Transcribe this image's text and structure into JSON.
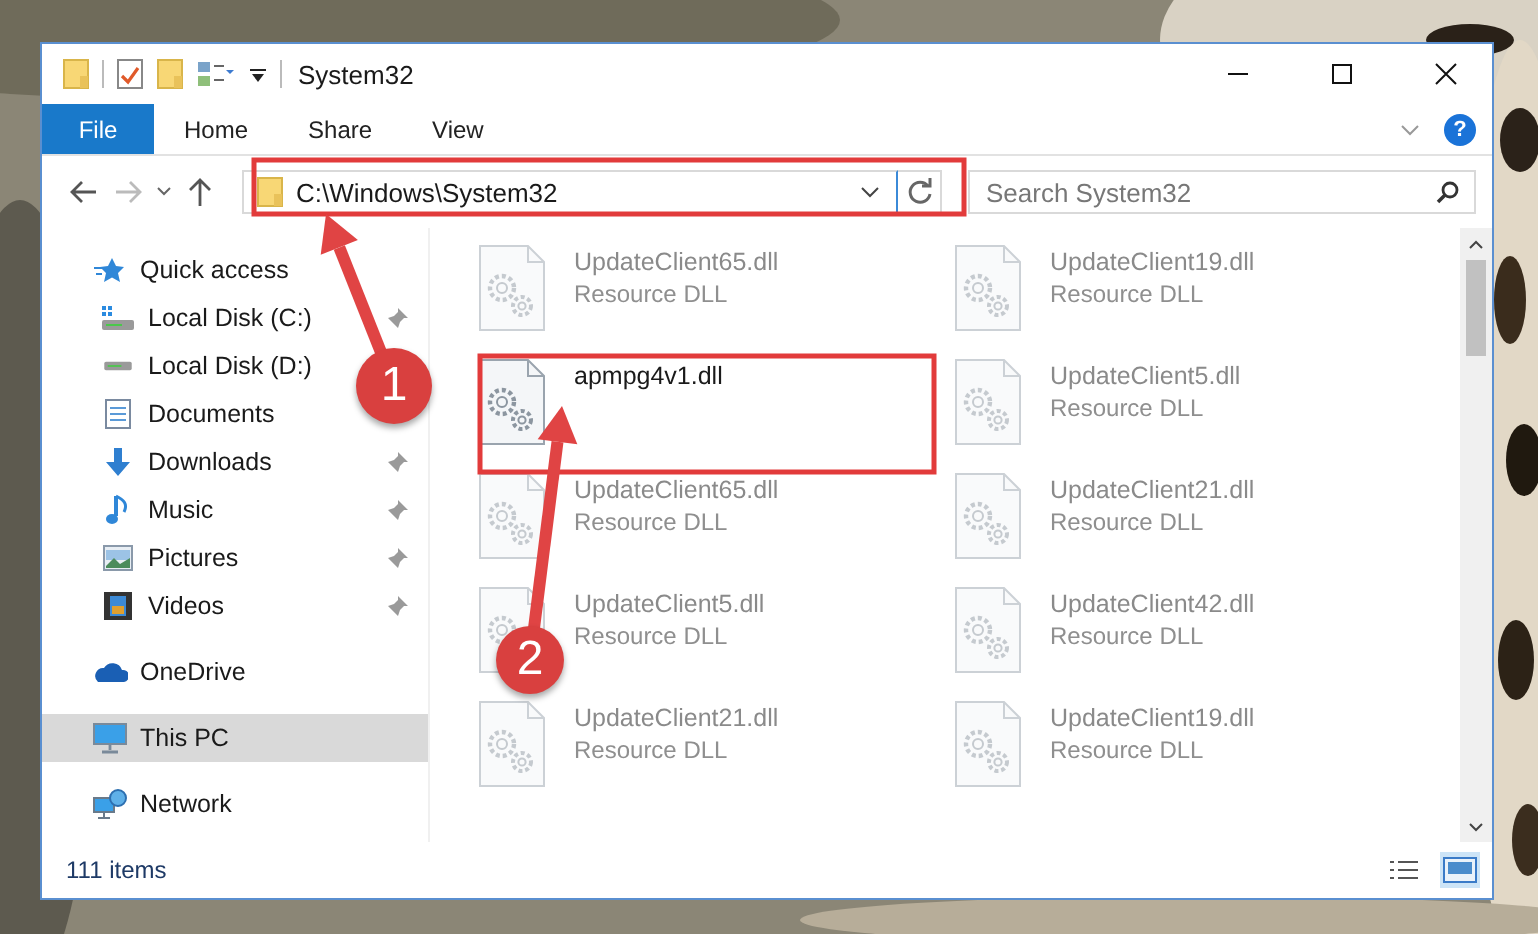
{
  "window": {
    "title": "System32"
  },
  "ribbon": {
    "tabs": [
      {
        "label": "File",
        "kind": "file"
      },
      {
        "label": "Home",
        "kind": "tab"
      },
      {
        "label": "Share",
        "kind": "tab"
      },
      {
        "label": "View",
        "kind": "tab"
      }
    ],
    "help": "?"
  },
  "address": {
    "path": "C:\\Windows\\System32"
  },
  "search": {
    "placeholder": "Search System32"
  },
  "sidebar": {
    "items": [
      {
        "label": "Quick access",
        "kind": "star",
        "selected": false,
        "children": [
          {
            "label": "Local Disk (C:)",
            "kind": "drive-c",
            "pinned": true,
            "selected": false
          },
          {
            "label": "Local Disk (D:)",
            "kind": "drive",
            "pinned": false,
            "selected": false
          },
          {
            "label": "Documents",
            "kind": "documents",
            "pinned": false,
            "selected": false
          },
          {
            "label": "Downloads",
            "kind": "downloads",
            "pinned": true,
            "selected": false
          },
          {
            "label": "Music",
            "kind": "music",
            "pinned": true,
            "selected": false
          },
          {
            "label": "Pictures",
            "kind": "pictures",
            "pinned": true,
            "selected": false
          },
          {
            "label": "Videos",
            "kind": "videos",
            "pinned": true,
            "selected": false
          }
        ]
      },
      {
        "label": "OneDrive",
        "kind": "cloud",
        "selected": false
      },
      {
        "label": "This PC",
        "kind": "pc",
        "selected": true
      },
      {
        "label": "Network",
        "kind": "network",
        "selected": false
      }
    ]
  },
  "files": [
    {
      "name": "UpdateClient65.dll",
      "type": "Resource DLL",
      "dimmed": true
    },
    {
      "name": "UpdateClient19.dll",
      "type": "Resource DLL",
      "dimmed": true
    },
    {
      "name": "apmpg4v1.dll",
      "dimmed": false
    },
    {
      "name": "UpdateClient5.dll",
      "type": "Resource DLL",
      "dimmed": true
    },
    {
      "name": "UpdateClient65.dll",
      "type": "Resource DLL",
      "dimmed": true
    },
    {
      "name": "UpdateClient21.dll",
      "type": "Resource DLL",
      "dimmed": true
    },
    {
      "name": "UpdateClient5.dll",
      "type": "Resource DLL",
      "dimmed": true
    },
    {
      "name": "UpdateClient42.dll",
      "type": "Resource DLL",
      "dimmed": true
    },
    {
      "name": "UpdateClient21.dll",
      "type": "Resource DLL",
      "dimmed": true
    },
    {
      "name": "UpdateClient19.dll",
      "type": "Resource DLL",
      "dimmed": true
    }
  ],
  "status_bar": {
    "count": "111 items"
  },
  "annotations": [
    {
      "label": "1"
    },
    {
      "label": "2"
    }
  ]
}
